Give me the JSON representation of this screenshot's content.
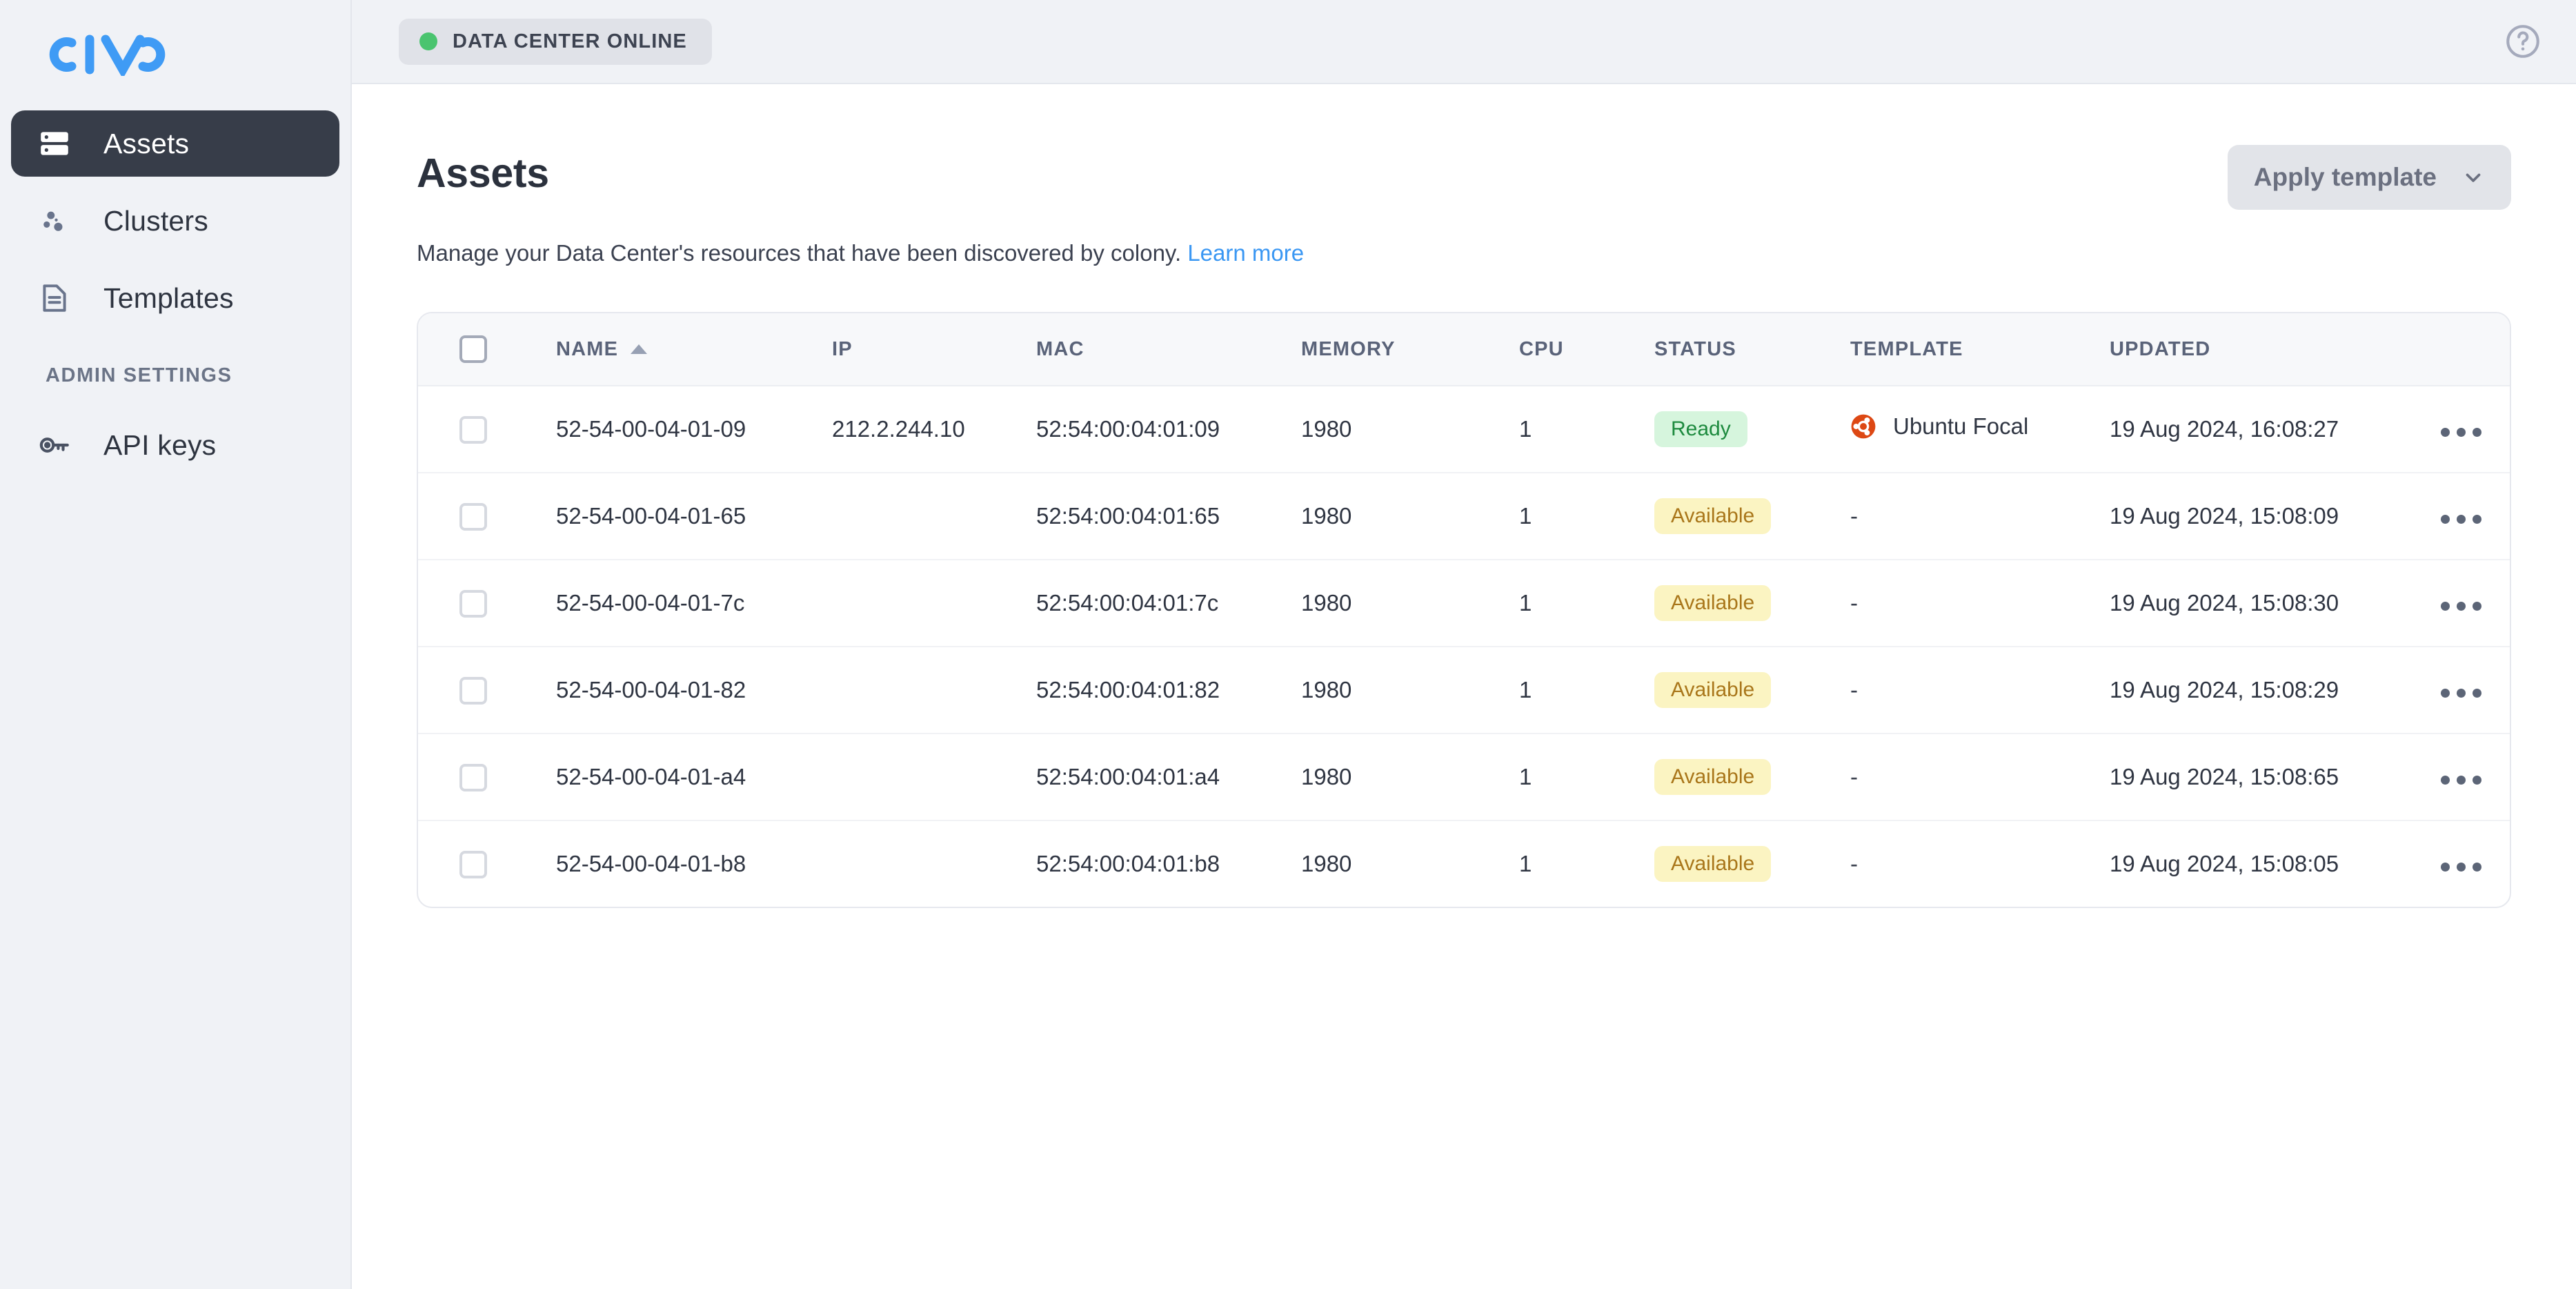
{
  "brand": {
    "logo_text": "CIVO",
    "logo_color": "#3f9bf5"
  },
  "sidebar": {
    "items": [
      {
        "label": "Assets",
        "icon": "server-icon",
        "active": true
      },
      {
        "label": "Clusters",
        "icon": "clusters-icon",
        "active": false
      },
      {
        "label": "Templates",
        "icon": "document-icon",
        "active": false
      }
    ],
    "section_title": "ADMIN SETTINGS",
    "admin_items": [
      {
        "label": "API keys",
        "icon": "key-icon",
        "active": false
      }
    ]
  },
  "topbar": {
    "status_label": "DATA CENTER ONLINE",
    "status_color": "#4ac46f",
    "help_icon": "question-circle-icon"
  },
  "page": {
    "title": "Assets",
    "description_prefix": "Manage your Data Center's resources that have been discovered by colony.",
    "learn_more": "Learn more",
    "apply_template_label": "Apply template"
  },
  "table": {
    "columns": [
      {
        "key": "name",
        "label": "NAME",
        "sorted": "asc"
      },
      {
        "key": "ip",
        "label": "IP"
      },
      {
        "key": "mac",
        "label": "MAC"
      },
      {
        "key": "memory",
        "label": "MEMORY"
      },
      {
        "key": "cpu",
        "label": "CPU"
      },
      {
        "key": "status",
        "label": "STATUS"
      },
      {
        "key": "template",
        "label": "TEMPLATE"
      },
      {
        "key": "updated",
        "label": "UPDATED"
      }
    ],
    "rows": [
      {
        "name": "52-54-00-04-01-09",
        "ip": "212.2.244.10",
        "mac": "52:54:00:04:01:09",
        "memory": "1980",
        "cpu": "1",
        "status": "Ready",
        "status_kind": "ready",
        "template": "Ubuntu Focal",
        "template_icon": "ubuntu-icon",
        "updated": "19 Aug 2024, 16:08:27"
      },
      {
        "name": "52-54-00-04-01-65",
        "ip": "",
        "mac": "52:54:00:04:01:65",
        "memory": "1980",
        "cpu": "1",
        "status": "Available",
        "status_kind": "available",
        "template": "-",
        "template_icon": "",
        "updated": "19 Aug 2024, 15:08:09"
      },
      {
        "name": "52-54-00-04-01-7c",
        "ip": "",
        "mac": "52:54:00:04:01:7c",
        "memory": "1980",
        "cpu": "1",
        "status": "Available",
        "status_kind": "available",
        "template": "-",
        "template_icon": "",
        "updated": "19 Aug 2024, 15:08:30"
      },
      {
        "name": "52-54-00-04-01-82",
        "ip": "",
        "mac": "52:54:00:04:01:82",
        "memory": "1980",
        "cpu": "1",
        "status": "Available",
        "status_kind": "available",
        "template": "-",
        "template_icon": "",
        "updated": "19 Aug 2024, 15:08:29"
      },
      {
        "name": "52-54-00-04-01-a4",
        "ip": "",
        "mac": "52:54:00:04:01:a4",
        "memory": "1980",
        "cpu": "1",
        "status": "Available",
        "status_kind": "available",
        "template": "-",
        "template_icon": "",
        "updated": "19 Aug 2024, 15:08:65"
      },
      {
        "name": "52-54-00-04-01-b8",
        "ip": "",
        "mac": "52:54:00:04:01:b8",
        "memory": "1980",
        "cpu": "1",
        "status": "Available",
        "status_kind": "available",
        "template": "-",
        "template_icon": "",
        "updated": "19 Aug 2024, 15:08:05"
      }
    ]
  },
  "colors": {
    "accent": "#3f9bf5",
    "sidebar_bg": "#f0f2f6",
    "active_nav": "#373d49",
    "ready_bg": "#d6f5dd",
    "ready_fg": "#1d8a3e",
    "available_bg": "#fbf4c2",
    "available_fg": "#a9761a",
    "ubuntu_orange": "#dd4814"
  }
}
